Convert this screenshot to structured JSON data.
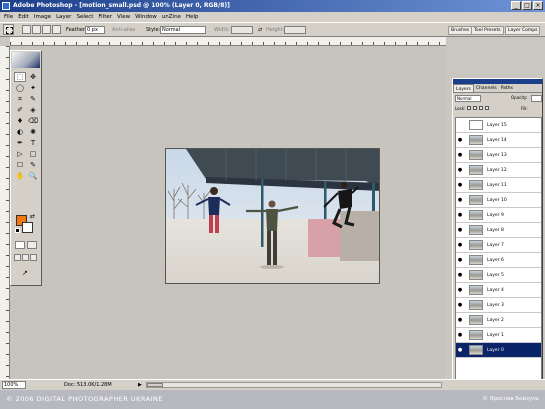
{
  "titlebar": {
    "title": "Adobe Photoshop - [motion_small.psd @ 100% (Layer 0, RGB/8)]",
    "buttons": [
      "_",
      "□",
      "×"
    ]
  },
  "menubar": {
    "items": [
      "File",
      "Edit",
      "Image",
      "Layer",
      "Select",
      "Filter",
      "View",
      "Window",
      "unZine",
      "Help"
    ]
  },
  "options": {
    "feather_label": "Feather:",
    "feather_value": "0 px",
    "antialias_label": "Anti-alias",
    "style_label": "Style:",
    "style_value": "Normal",
    "width_label": "Width:",
    "height_label": "Height:",
    "dock_tabs": [
      "Brushes",
      "Tool Presets",
      "Layer Comps"
    ]
  },
  "toolbox": {
    "tools": [
      "⬚",
      "✥",
      "◯",
      "✦",
      "⌗",
      "✎",
      "✐",
      "◈",
      "♦",
      "⌫",
      "◐",
      "✺",
      "✒",
      "T",
      "▷",
      "□",
      "☐",
      "✎",
      "✋",
      "🔍"
    ],
    "foreground_color": "#f07810",
    "background_color": "#ffffff",
    "jump_icon": "↗"
  },
  "layers_panel": {
    "tabs": [
      "Layers",
      "Channels",
      "Paths"
    ],
    "blend_mode": "Normal",
    "opacity_label": "Opacity:",
    "lock_label": "Lock:",
    "fill_label": "Fill:",
    "layers": [
      {
        "name": "Layer 15",
        "visible": false,
        "selected": false,
        "blank": true
      },
      {
        "name": "Layer 14",
        "visible": true,
        "selected": false
      },
      {
        "name": "Layer 13",
        "visible": true,
        "selected": false
      },
      {
        "name": "Layer 12",
        "visible": true,
        "selected": false
      },
      {
        "name": "Layer 11",
        "visible": true,
        "selected": false
      },
      {
        "name": "Layer 10",
        "visible": true,
        "selected": false
      },
      {
        "name": "Layer 9",
        "visible": true,
        "selected": false
      },
      {
        "name": "Layer 8",
        "visible": true,
        "selected": false
      },
      {
        "name": "Layer 7",
        "visible": true,
        "selected": false
      },
      {
        "name": "Layer 6",
        "visible": true,
        "selected": false
      },
      {
        "name": "Layer 5",
        "visible": true,
        "selected": false
      },
      {
        "name": "Layer 4",
        "visible": true,
        "selected": false
      },
      {
        "name": "Layer 3",
        "visible": true,
        "selected": false
      },
      {
        "name": "Layer 2",
        "visible": true,
        "selected": false
      },
      {
        "name": "Layer 1",
        "visible": true,
        "selected": false
      },
      {
        "name": "Layer 0",
        "visible": true,
        "selected": true
      }
    ]
  },
  "statusbar": {
    "zoom": "100%",
    "doc_info": "Doc: 513.0K/1.28M",
    "arrow": "▶"
  },
  "footer": {
    "left": "© 2006  DIGITAL PHOTOGRAPHER UKRAINE",
    "right": "© Ярослав Бойзуль"
  }
}
